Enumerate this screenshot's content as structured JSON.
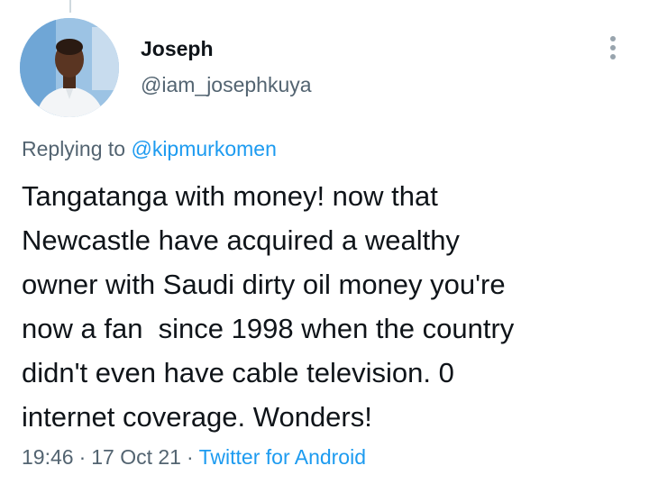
{
  "author": {
    "display_name": "Joseph",
    "handle": "@iam_josephkuya",
    "avatar_icon": "user-avatar-photo"
  },
  "reply_context": {
    "prefix": "Replying to",
    "mention": "@kipmurkomen"
  },
  "tweet": {
    "text": "Tangatanga with money! now that\nNewcastle have acquired a wealthy\nowner with Saudi dirty oil money you're\nnow a fan  since 1998 when the country\ndidn't even have cable television. 0\ninternet coverage. Wonders!"
  },
  "meta": {
    "time": "19:46",
    "separator": "·",
    "date": "17 Oct 21",
    "source": "Twitter for Android"
  },
  "menu": {
    "icon": "more-vertical-icon"
  },
  "colors": {
    "accent": "#1d9bf0",
    "secondary_text": "#536471",
    "primary_text": "#0f1419"
  }
}
